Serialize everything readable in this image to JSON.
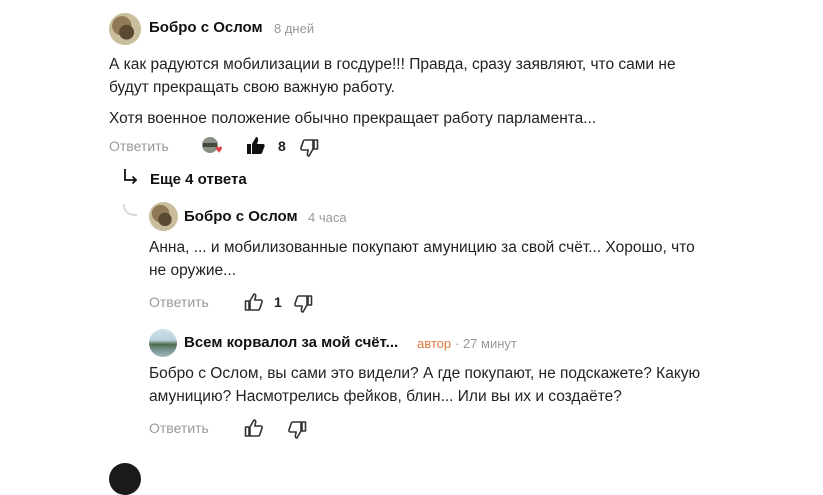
{
  "comments": [
    {
      "author": "Бобро с Ослом",
      "time": "8 дней",
      "paragraphs": [
        "А как радуются мобилизации в госдуре!!! Правда, сразу заявляют, что сами не будут прекращать свою важную работу.",
        "Хотя военное положение обычно прекращает работу парламента..."
      ],
      "reply_label": "Ответить",
      "likes": "8"
    },
    {
      "author": "Бобро с Ослом",
      "time": "4 часа",
      "paragraphs": [
        "Анна, ... и мобилизованные покупают амуницию за свой счёт... Хорошо, что не оружие..."
      ],
      "reply_label": "Ответить",
      "likes": "1"
    },
    {
      "author": "Всем корвалол за мой счёт...",
      "badge": "автор",
      "time": "· 27 минут",
      "paragraphs": [
        "Бобро с Ослом, вы сами это видели? А где покупают, не подскажете? Какую амуницию? Насмотрелись фейков, блин... Или вы их и создаёте?"
      ],
      "reply_label": "Ответить",
      "likes": ""
    }
  ],
  "more_replies": "Еще 4 ответа",
  "icons": {
    "reaction": "reaction-heart-icon",
    "like": "thumbs-up-icon",
    "dislike": "thumbs-down-icon",
    "reply_arrow": "reply-arrow-icon",
    "thread": "thread-connector-icon"
  },
  "colors": {
    "badge": "#e07a3c",
    "muted": "#999999",
    "heart": "#e5414a"
  }
}
